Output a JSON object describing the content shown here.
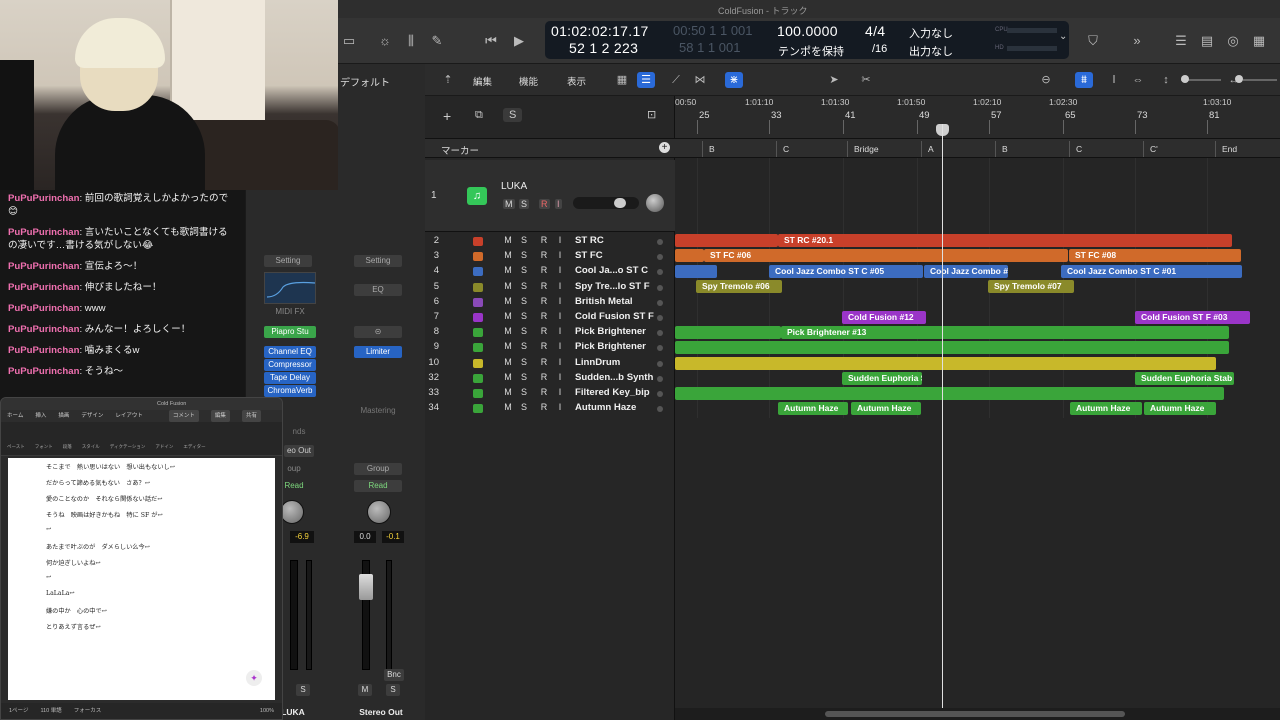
{
  "window": {
    "title": "ColdFusion - トラック"
  },
  "chat": [
    {
      "user": "PuPuPurinchan",
      "text": "前回の歌詞覚えしかよかったので😊"
    },
    {
      "user": "PuPuPurinchan",
      "text": "言いたいことなくても歌詞書けるの凄いです…書ける気がしない😂"
    },
    {
      "user": "PuPuPurinchan",
      "text": "宣伝よろ〜！"
    },
    {
      "user": "PuPuPurinchan",
      "text": "伸びましたねー！"
    },
    {
      "user": "PuPuPurinchan",
      "text": "www"
    },
    {
      "user": "PuPuPurinchan",
      "text": "みんなー！よろしくー！"
    },
    {
      "user": "PuPuPurinchan",
      "text": "噛みまくるw"
    },
    {
      "user": "PuPuPurinchan",
      "text": "そうね〜"
    }
  ],
  "transport": {
    "time": "01:02:02:17.17",
    "time_dim": "00:50 1 1 001",
    "bars": "52 1 2 223",
    "bars_dim": "58 1 1 001",
    "tempo": "100.0000",
    "tempo_label": "テンポを保持",
    "signature": "4/4",
    "division": "/16",
    "input": "入力なし",
    "output": "出力なし",
    "cpu_label": "CPU",
    "hd_label": "HD"
  },
  "inspector": {
    "label": "デフォルト"
  },
  "toolbar": {
    "edit": "編集",
    "function": "機能",
    "view": "表示"
  },
  "header_buttons": {
    "add": "+",
    "dup": "⧉",
    "solo": "S"
  },
  "marker_label": "マーカー",
  "ruler": {
    "times": [
      "00:50",
      "1:01:10",
      "1:01:30",
      "1:01:50",
      "1:02:10",
      "1:02:30",
      "1:03:10"
    ],
    "bars": [
      "25",
      "33",
      "41",
      "49",
      "57",
      "65",
      "73",
      "81"
    ]
  },
  "markers": [
    "B",
    "C",
    "Bridge",
    "A",
    "B",
    "C",
    "C'",
    "End"
  ],
  "luka": {
    "num": "1",
    "name": "LUKA",
    "m": "M",
    "s": "S",
    "r": "R",
    "i": "I"
  },
  "tracks": [
    {
      "num": "2",
      "name": "ST RC",
      "color": "#c8402a"
    },
    {
      "num": "3",
      "name": "ST FC",
      "color": "#d06a2a"
    },
    {
      "num": "4",
      "name": "Cool Ja...o ST C",
      "color": "#3c6cc0"
    },
    {
      "num": "5",
      "name": "Spy Tre...lo ST F",
      "color": "#8a8a2a"
    },
    {
      "num": "6",
      "name": "British Metal",
      "color": "#8a4ab8"
    },
    {
      "num": "7",
      "name": "Cold Fusion ST F",
      "color": "#9a35c8"
    },
    {
      "num": "8",
      "name": "Pick Brightener",
      "color": "#3aa53a"
    },
    {
      "num": "9",
      "name": "Pick Brightener",
      "color": "#3aa53a"
    },
    {
      "num": "10",
      "name": "LinnDrum",
      "color": "#c8b82a"
    },
    {
      "num": "32",
      "name": "Sudden...b Synth",
      "color": "#3aa53a"
    },
    {
      "num": "33",
      "name": "Filtered Key_bip",
      "color": "#3aa53a"
    },
    {
      "num": "34",
      "name": "Autumn Haze",
      "color": "#3aa53a"
    }
  ],
  "regions": {
    "st_rc": "ST RC #20.1",
    "st_fc1": "ST FC #06",
    "st_fc2": "ST FC #08",
    "cool1": "Cool Jazz Combo ST C #05",
    "cool2": "Cool Jazz Combo #",
    "cool3": "Cool Jazz Combo ST C #01",
    "spy1": "Spy Tremolo #06",
    "spy2": "Spy Tremolo #07",
    "cold1": "Cold Fusion #12",
    "cold2": "Cold Fusion ST F #03",
    "pick": "Pick Brightener #13",
    "sudden1": "Sudden Euphoria S",
    "sudden2": "Sudden Euphoria Stab",
    "autumn": "Autumn Haze"
  },
  "mixer": {
    "setting": "Setting",
    "midi_fx": "MIDI FX",
    "eq": "EQ",
    "plugins": [
      "Piapro Stu",
      "Channel EQ",
      "Compressor",
      "Tape Delay",
      "ChromaVerb"
    ],
    "limiter": "Limiter",
    "mastering": "Mastering",
    "sends": "nds",
    "out": "eo Out",
    "group": "Group",
    "read": "Read",
    "vol1": "-6.9",
    "vol2a": "0.0",
    "vol2b": "-0.1",
    "bnc": "Bnc",
    "m": "M",
    "s": "S",
    "name1": "LUKA",
    "name2": "Stereo Out"
  },
  "word": {
    "title": "Cold Fusion",
    "tabs": [
      "ホーム",
      "挿入",
      "描画",
      "デザイン",
      "レイアウト"
    ],
    "comment": "コメント",
    "edit": "編集",
    "share": "共有",
    "tools": [
      "ペースト",
      "フォント",
      "段落",
      "スタイル",
      "ディクテーション",
      "アドイン",
      "エディター"
    ],
    "lines": [
      "そこまで　熱い思いはない　想い出もないし↩",
      "だからって諦める気もない　さあ？↩",
      "愛のことなのか　それなら関係ない話だ↩",
      "そうね　映画は好きかもね　特に SF が↩",
      "↩",
      "あたまで叶ぶのが　ダメらしい么今↩",
      "何か迫ぎしいよね↩",
      "↩",
      "LaLaLa↩",
      "嫌の中か　心の中で↩",
      "とりあえず言るぜ↩"
    ],
    "status_pages": "1ページ",
    "status_words": "110 単語",
    "status_focus": "フォーカス",
    "zoom": "100%"
  }
}
